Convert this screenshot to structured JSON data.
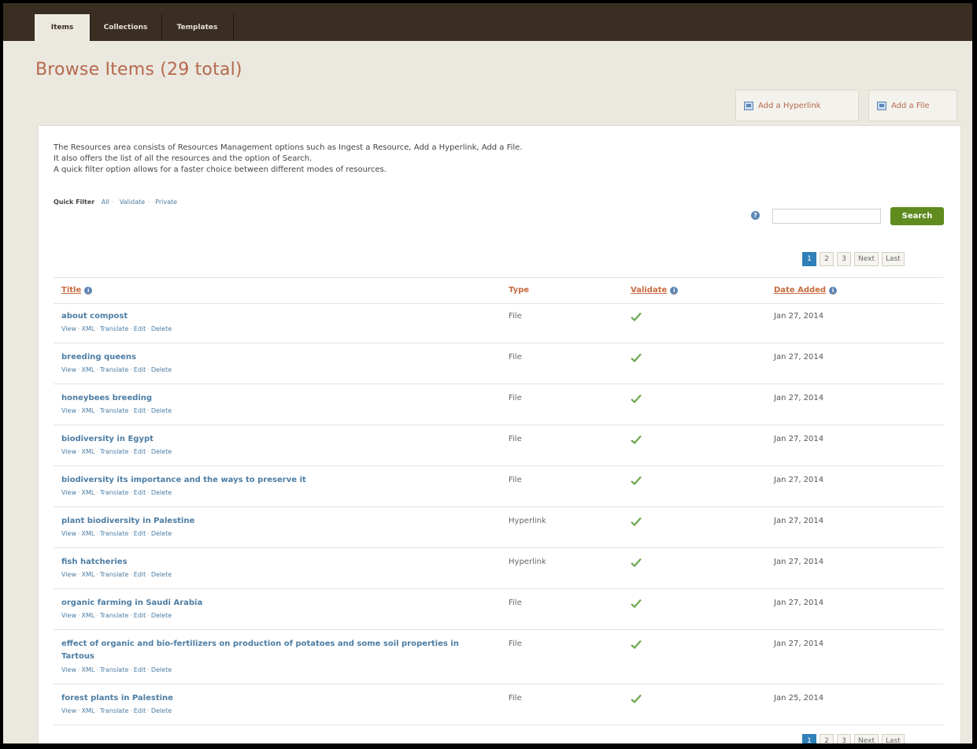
{
  "tabs": [
    {
      "label": "Items",
      "active": true
    },
    {
      "label": "Collections",
      "active": false
    },
    {
      "label": "Templates",
      "active": false
    }
  ],
  "page_title": "Browse Items (29 total)",
  "actions": {
    "add_hyperlink": "Add a Hyperlink",
    "add_file": "Add a File"
  },
  "intro": {
    "line1": "The Resources area consists of Resources Management options such as Ingest a Resource, Add a Hyperlink, Add a File.",
    "line2": "It also offers the list of all the resources and the option of Search.",
    "line3": "A quick filter option allows for a faster choice between different modes of resources."
  },
  "quick_filter": {
    "label": "Quick Filter",
    "options": [
      "All",
      "Validate",
      "Private"
    ]
  },
  "search": {
    "value": "",
    "button_label": "Search"
  },
  "pagination": {
    "pages": [
      "1",
      "2",
      "3"
    ],
    "current": "1",
    "next": "Next",
    "last": "Last"
  },
  "columns": {
    "title": "Title",
    "type": "Type",
    "validate": "Validate",
    "date_added": "Date Added"
  },
  "row_action_labels": [
    "View",
    "XML",
    "Translate",
    "Edit",
    "Delete"
  ],
  "items": [
    {
      "title": "about compost",
      "type": "File",
      "validated": true,
      "date": "Jan 27, 2014"
    },
    {
      "title": "breeding queens",
      "type": "File",
      "validated": true,
      "date": "Jan 27, 2014"
    },
    {
      "title": "honeybees breeding",
      "type": "File",
      "validated": true,
      "date": "Jan 27, 2014"
    },
    {
      "title": "biodiversity in Egypt",
      "type": "File",
      "validated": true,
      "date": "Jan 27, 2014"
    },
    {
      "title": "biodiversity its importance and the ways to preserve it",
      "type": "File",
      "validated": true,
      "date": "Jan 27, 2014"
    },
    {
      "title": "plant biodiversity in Palestine",
      "type": "Hyperlink",
      "validated": true,
      "date": "Jan 27, 2014"
    },
    {
      "title": "fish hatcheries",
      "type": "Hyperlink",
      "validated": true,
      "date": "Jan 27, 2014"
    },
    {
      "title": "organic farming in Saudi Arabia",
      "type": "File",
      "validated": true,
      "date": "Jan 27, 2014"
    },
    {
      "title": "effect of organic and bio-fertilizers on production of potatoes and some soil properties in Tartous",
      "type": "File",
      "validated": true,
      "date": "Jan 27, 2014"
    },
    {
      "title": "forest plants in Palestine",
      "type": "File",
      "validated": true,
      "date": "Jan 25, 2014"
    }
  ],
  "colors": {
    "topbar": "#3a2d22",
    "accent": "#b5694e",
    "link": "#4c7da4",
    "search_button": "#5f8b1f",
    "check": "#6aa84f"
  }
}
